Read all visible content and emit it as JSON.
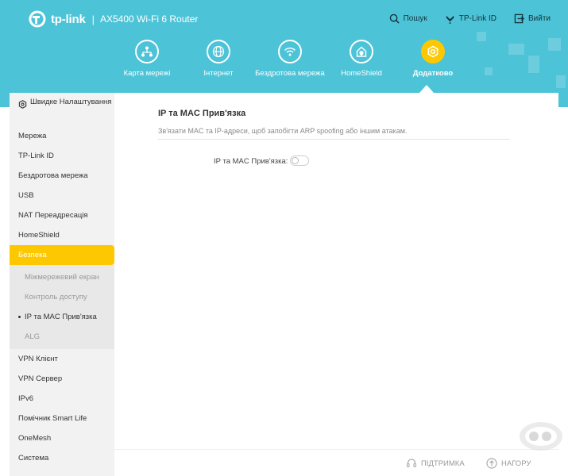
{
  "header": {
    "brand": "tp-link",
    "model": "AX5400 Wi-Fi 6 Router",
    "actions": [
      {
        "label": "Пошук",
        "icon": "search-icon"
      },
      {
        "label": "TP-Link ID",
        "icon": "tplink-id-icon"
      },
      {
        "label": "Вийти",
        "icon": "logout-icon"
      }
    ],
    "nav": [
      {
        "label": "Карта мережі",
        "icon": "network-map-icon"
      },
      {
        "label": "Інтернет",
        "icon": "globe-icon"
      },
      {
        "label": "Бездротова мережа",
        "icon": "wifi-icon"
      },
      {
        "label": "HomeShield",
        "icon": "home-shield-icon"
      },
      {
        "label": "Додатково",
        "icon": "gear-icon",
        "active": true
      }
    ]
  },
  "sidebar": {
    "quick": "Швидке Налаштування",
    "items_top": [
      "Мережа",
      "TP-Link ID",
      "Бездротова мережа",
      "USB",
      "NAT Переадресація",
      "HomeShield"
    ],
    "active": "Безпека",
    "sub": [
      "Міжмережевий екран",
      "Контроль доступу",
      "IP та MAC Прив'язка",
      "ALG"
    ],
    "items_bottom": [
      "VPN Клієнт",
      "VPN Сервер",
      "IPv6",
      "Помічник Smart Life",
      "OneMesh",
      "Система"
    ]
  },
  "main": {
    "title": "IP та MAC Прив'язка",
    "description": "Зв'язати MAC та IP-адреси, щоб запобігти ARP spoofing або іншим атакам.",
    "field_label": "IP та MAC Прив'язка:",
    "toggle_on": false
  },
  "footer": {
    "support": "ПІДТРИМКА",
    "top": "НАГОРУ"
  },
  "colors": {
    "header": "#4cc3d7",
    "accent": "#fec800"
  }
}
